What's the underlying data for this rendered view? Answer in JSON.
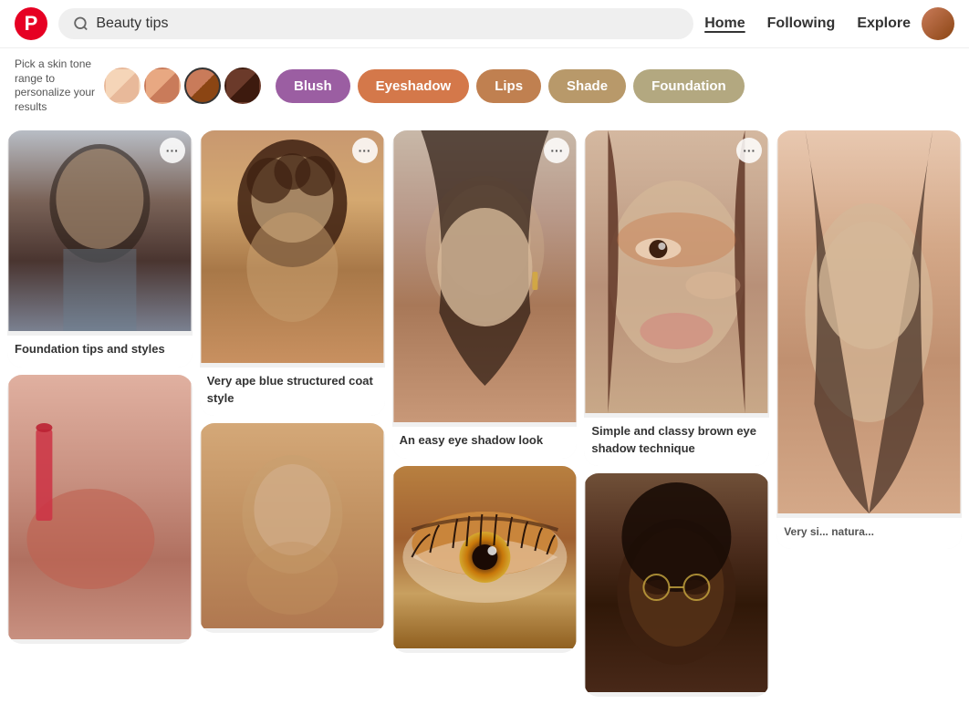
{
  "header": {
    "logo_letter": "P",
    "search_placeholder": "Beauty tips",
    "nav": {
      "home": "Home",
      "following": "Following",
      "explore": "Explore"
    }
  },
  "skin_tone": {
    "label": "Pick a skin tone range to personalize your results",
    "swatches": [
      {
        "id": 1,
        "label": "Light"
      },
      {
        "id": 2,
        "label": "Medium-light"
      },
      {
        "id": 3,
        "label": "Medium",
        "selected": true
      },
      {
        "id": 4,
        "label": "Dark"
      }
    ]
  },
  "filter_pills": [
    {
      "id": "blush",
      "label": "Blush",
      "color": "#9b5ea2"
    },
    {
      "id": "eyeshadow",
      "label": "Eyeshadow",
      "color": "#d4784a"
    },
    {
      "id": "lips",
      "label": "Lips",
      "color": "#c08050"
    },
    {
      "id": "shade",
      "label": "Shade",
      "color": "#b8996a"
    },
    {
      "id": "foundation",
      "label": "Foundation",
      "color": "#b3a880"
    }
  ],
  "pins": [
    {
      "id": 1,
      "title": "Foundation tips and styles",
      "col": 1,
      "height_type": "tall"
    },
    {
      "id": 2,
      "title": "Very ape blue structured coat style",
      "col": 2,
      "height_type": "tall"
    },
    {
      "id": 3,
      "title": "An easy eye shadow look",
      "col": 3,
      "height_type": "very-tall"
    },
    {
      "id": 4,
      "title": "Simple and classy brown eye shadow technique",
      "col": 4,
      "height_type": "very-tall"
    },
    {
      "id": 5,
      "title": "",
      "col": 1,
      "height_type": "tall"
    },
    {
      "id": 6,
      "title": "",
      "col": 2,
      "height_type": "medium"
    },
    {
      "id": 7,
      "title": "",
      "col": 3,
      "height_type": "medium"
    },
    {
      "id": 8,
      "title": "",
      "col": 4,
      "height_type": "medium"
    },
    {
      "id": 9,
      "title": "Very si... natura...",
      "col": 5,
      "height_type": "tall",
      "partial": true
    }
  ],
  "more_icon": "···"
}
